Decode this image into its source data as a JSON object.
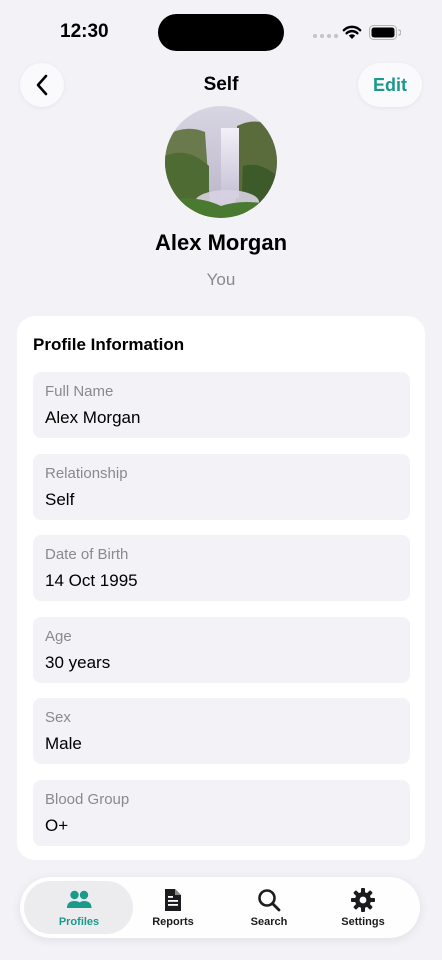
{
  "status_bar": {
    "time": "12:30"
  },
  "header": {
    "title": "Self",
    "edit_label": "Edit"
  },
  "profile": {
    "name": "Alex Morgan",
    "subtitle": "You"
  },
  "card": {
    "title": "Profile Information",
    "fields": [
      {
        "label": "Full Name",
        "value": "Alex Morgan"
      },
      {
        "label": "Relationship",
        "value": "Self"
      },
      {
        "label": "Date of Birth",
        "value": "14 Oct 1995"
      },
      {
        "label": "Age",
        "value": "30 years"
      },
      {
        "label": "Sex",
        "value": "Male"
      },
      {
        "label": "Blood Group",
        "value": "O+"
      }
    ]
  },
  "tabs": [
    {
      "label": "Profiles",
      "icon": "people-icon",
      "active": true
    },
    {
      "label": "Reports",
      "icon": "document-icon",
      "active": false
    },
    {
      "label": "Search",
      "icon": "search-icon",
      "active": false
    },
    {
      "label": "Settings",
      "icon": "gear-icon",
      "active": false
    }
  ],
  "colors": {
    "accent": "#1a9a8a",
    "background": "#f2f2f7",
    "card": "#ffffff"
  }
}
